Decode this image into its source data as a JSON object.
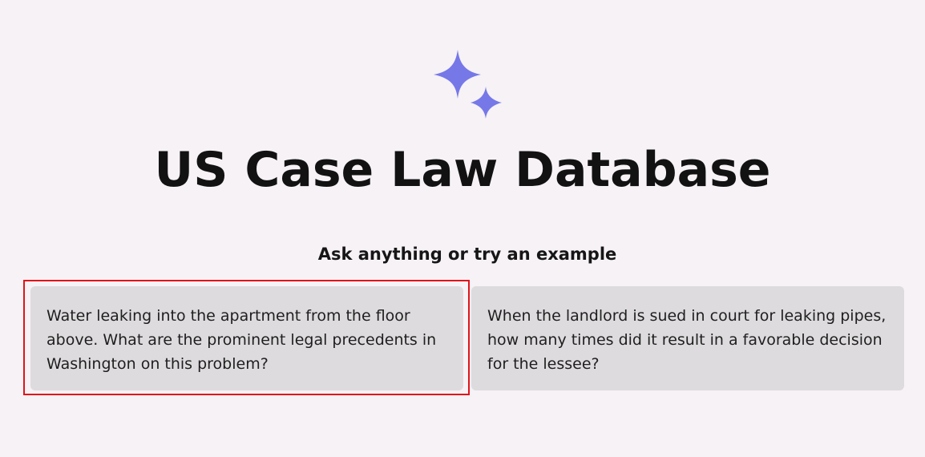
{
  "app": {
    "title": "US Case Law Database",
    "subtitle": "Ask anything or try an example",
    "logo_icon": "sparkles-icon",
    "accent_color": "#7678e8"
  },
  "examples": [
    {
      "text": "Water leaking into the apartment from the floor above. What are the prominent legal precedents in Washington on this problem?",
      "highlighted": true
    },
    {
      "text": "When the landlord is sued in court for leaking pipes, how many times did it result in a favorable decision for the lessee?",
      "highlighted": false
    }
  ],
  "highlight_color": "#e0141b"
}
